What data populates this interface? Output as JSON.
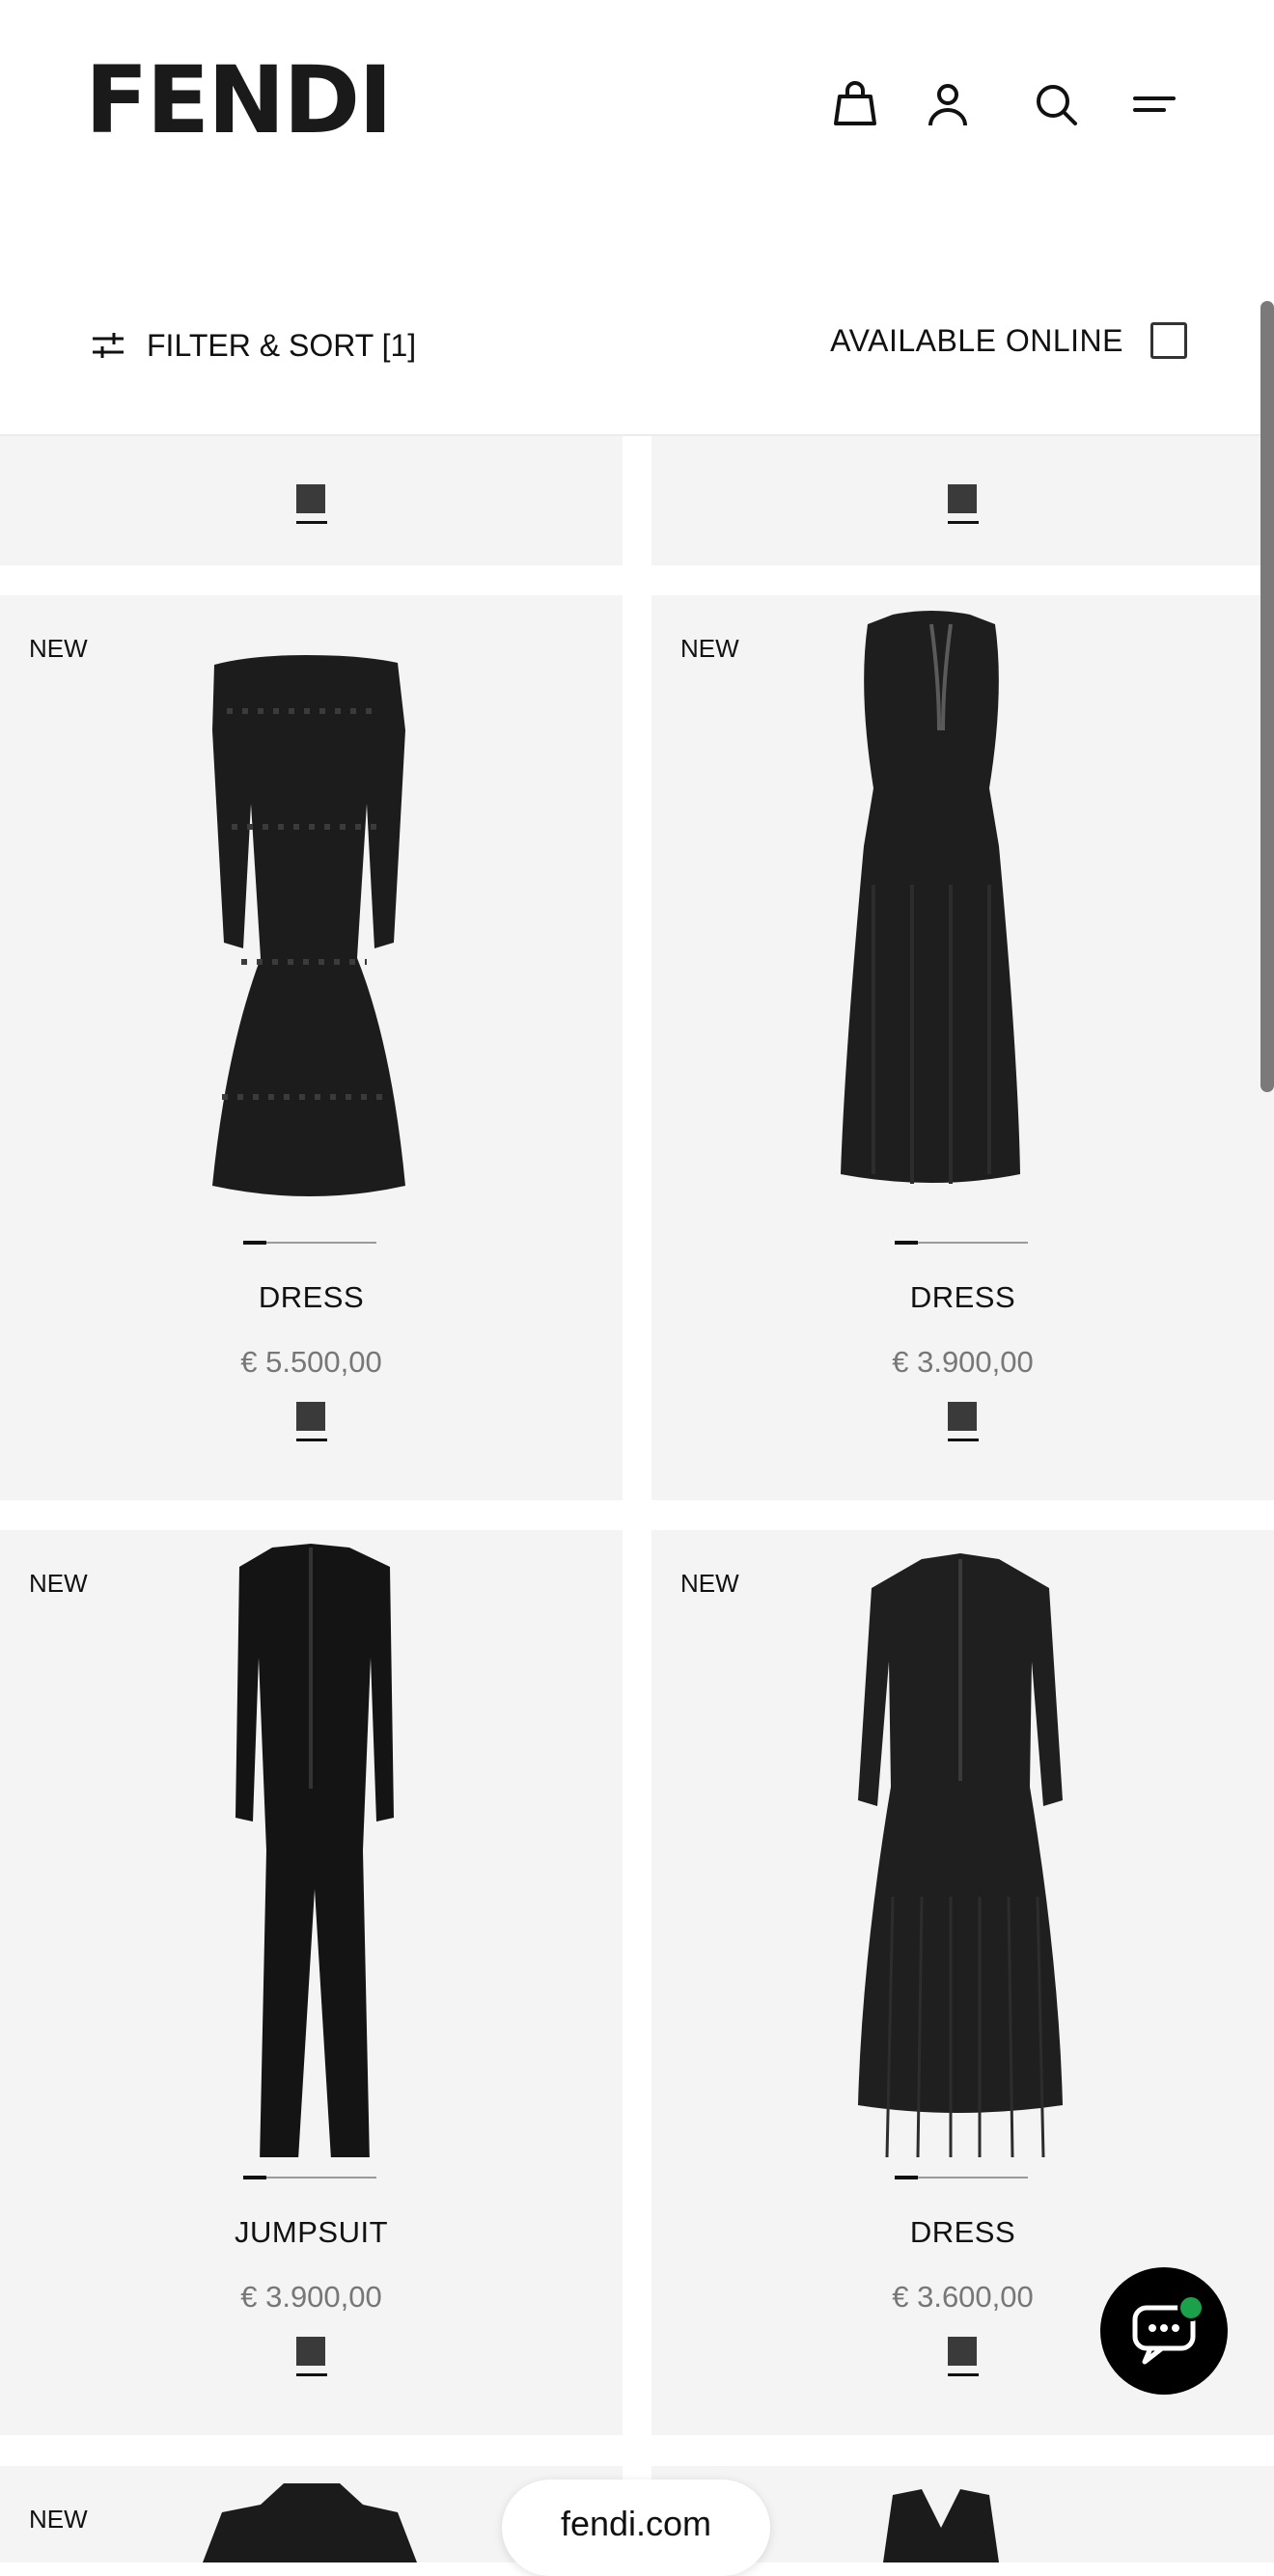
{
  "header": {
    "logo": "FENDI",
    "icons": [
      "bag-icon",
      "account-icon",
      "search-icon",
      "menu-icon"
    ],
    "filter_label": "FILTER & SORT [1]",
    "available_label": "AVAILABLE ONLINE",
    "available_checked": false
  },
  "products": [
    {
      "badge": "NEW",
      "name": "DRESS",
      "price": "€ 5.500,00"
    },
    {
      "badge": "NEW",
      "name": "DRESS",
      "price": "€ 3.900,00"
    },
    {
      "badge": "NEW",
      "name": "JUMPSUIT",
      "price": "€ 3.900,00"
    },
    {
      "badge": "NEW",
      "name": "DRESS",
      "price": "€ 3.600,00"
    },
    {
      "badge": "NEW"
    }
  ],
  "footer": {
    "domain": "fendi.com"
  },
  "colors": {
    "card_bg": "#f4f4f5",
    "accent_dot": "#1aa14a"
  }
}
